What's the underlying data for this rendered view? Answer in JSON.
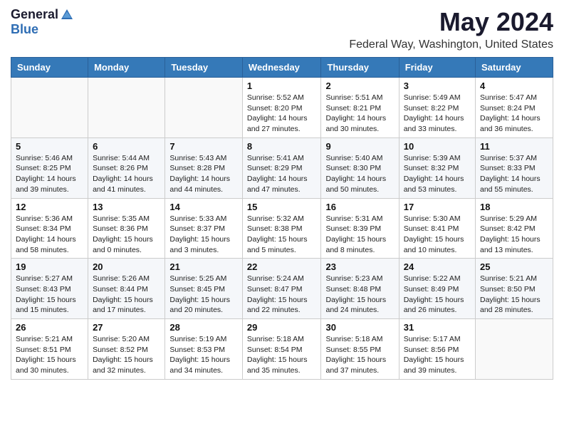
{
  "logo": {
    "general": "General",
    "blue": "Blue"
  },
  "title": "May 2024",
  "subtitle": "Federal Way, Washington, United States",
  "days_of_week": [
    "Sunday",
    "Monday",
    "Tuesday",
    "Wednesday",
    "Thursday",
    "Friday",
    "Saturday"
  ],
  "weeks": [
    [
      {
        "day": "",
        "info": ""
      },
      {
        "day": "",
        "info": ""
      },
      {
        "day": "",
        "info": ""
      },
      {
        "day": "1",
        "info": "Sunrise: 5:52 AM\nSunset: 8:20 PM\nDaylight: 14 hours and 27 minutes."
      },
      {
        "day": "2",
        "info": "Sunrise: 5:51 AM\nSunset: 8:21 PM\nDaylight: 14 hours and 30 minutes."
      },
      {
        "day": "3",
        "info": "Sunrise: 5:49 AM\nSunset: 8:22 PM\nDaylight: 14 hours and 33 minutes."
      },
      {
        "day": "4",
        "info": "Sunrise: 5:47 AM\nSunset: 8:24 PM\nDaylight: 14 hours and 36 minutes."
      }
    ],
    [
      {
        "day": "5",
        "info": "Sunrise: 5:46 AM\nSunset: 8:25 PM\nDaylight: 14 hours and 39 minutes."
      },
      {
        "day": "6",
        "info": "Sunrise: 5:44 AM\nSunset: 8:26 PM\nDaylight: 14 hours and 41 minutes."
      },
      {
        "day": "7",
        "info": "Sunrise: 5:43 AM\nSunset: 8:28 PM\nDaylight: 14 hours and 44 minutes."
      },
      {
        "day": "8",
        "info": "Sunrise: 5:41 AM\nSunset: 8:29 PM\nDaylight: 14 hours and 47 minutes."
      },
      {
        "day": "9",
        "info": "Sunrise: 5:40 AM\nSunset: 8:30 PM\nDaylight: 14 hours and 50 minutes."
      },
      {
        "day": "10",
        "info": "Sunrise: 5:39 AM\nSunset: 8:32 PM\nDaylight: 14 hours and 53 minutes."
      },
      {
        "day": "11",
        "info": "Sunrise: 5:37 AM\nSunset: 8:33 PM\nDaylight: 14 hours and 55 minutes."
      }
    ],
    [
      {
        "day": "12",
        "info": "Sunrise: 5:36 AM\nSunset: 8:34 PM\nDaylight: 14 hours and 58 minutes."
      },
      {
        "day": "13",
        "info": "Sunrise: 5:35 AM\nSunset: 8:36 PM\nDaylight: 15 hours and 0 minutes."
      },
      {
        "day": "14",
        "info": "Sunrise: 5:33 AM\nSunset: 8:37 PM\nDaylight: 15 hours and 3 minutes."
      },
      {
        "day": "15",
        "info": "Sunrise: 5:32 AM\nSunset: 8:38 PM\nDaylight: 15 hours and 5 minutes."
      },
      {
        "day": "16",
        "info": "Sunrise: 5:31 AM\nSunset: 8:39 PM\nDaylight: 15 hours and 8 minutes."
      },
      {
        "day": "17",
        "info": "Sunrise: 5:30 AM\nSunset: 8:41 PM\nDaylight: 15 hours and 10 minutes."
      },
      {
        "day": "18",
        "info": "Sunrise: 5:29 AM\nSunset: 8:42 PM\nDaylight: 15 hours and 13 minutes."
      }
    ],
    [
      {
        "day": "19",
        "info": "Sunrise: 5:27 AM\nSunset: 8:43 PM\nDaylight: 15 hours and 15 minutes."
      },
      {
        "day": "20",
        "info": "Sunrise: 5:26 AM\nSunset: 8:44 PM\nDaylight: 15 hours and 17 minutes."
      },
      {
        "day": "21",
        "info": "Sunrise: 5:25 AM\nSunset: 8:45 PM\nDaylight: 15 hours and 20 minutes."
      },
      {
        "day": "22",
        "info": "Sunrise: 5:24 AM\nSunset: 8:47 PM\nDaylight: 15 hours and 22 minutes."
      },
      {
        "day": "23",
        "info": "Sunrise: 5:23 AM\nSunset: 8:48 PM\nDaylight: 15 hours and 24 minutes."
      },
      {
        "day": "24",
        "info": "Sunrise: 5:22 AM\nSunset: 8:49 PM\nDaylight: 15 hours and 26 minutes."
      },
      {
        "day": "25",
        "info": "Sunrise: 5:21 AM\nSunset: 8:50 PM\nDaylight: 15 hours and 28 minutes."
      }
    ],
    [
      {
        "day": "26",
        "info": "Sunrise: 5:21 AM\nSunset: 8:51 PM\nDaylight: 15 hours and 30 minutes."
      },
      {
        "day": "27",
        "info": "Sunrise: 5:20 AM\nSunset: 8:52 PM\nDaylight: 15 hours and 32 minutes."
      },
      {
        "day": "28",
        "info": "Sunrise: 5:19 AM\nSunset: 8:53 PM\nDaylight: 15 hours and 34 minutes."
      },
      {
        "day": "29",
        "info": "Sunrise: 5:18 AM\nSunset: 8:54 PM\nDaylight: 15 hours and 35 minutes."
      },
      {
        "day": "30",
        "info": "Sunrise: 5:18 AM\nSunset: 8:55 PM\nDaylight: 15 hours and 37 minutes."
      },
      {
        "day": "31",
        "info": "Sunrise: 5:17 AM\nSunset: 8:56 PM\nDaylight: 15 hours and 39 minutes."
      },
      {
        "day": "",
        "info": ""
      }
    ]
  ]
}
